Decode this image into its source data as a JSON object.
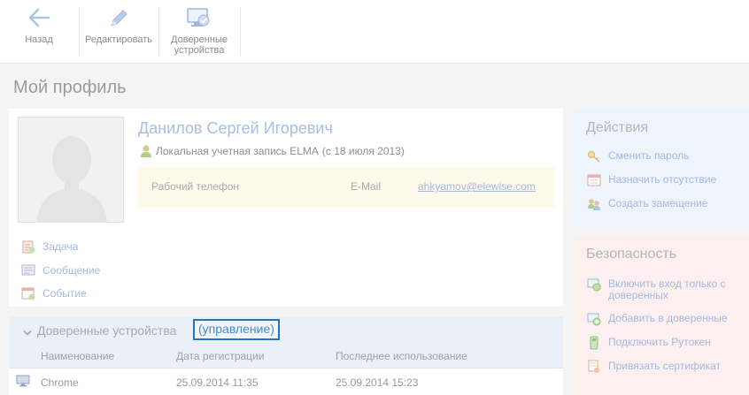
{
  "toolbar": {
    "back_label": "Назад",
    "edit_label": "Редактировать",
    "trusted_label_line1": "Доверенные",
    "trusted_label_line2": "устройства"
  },
  "page": {
    "title": "Мой профиль"
  },
  "profile": {
    "name": "Данилов Сергей Игоревич",
    "account_type": "Локальная учетная запись ELMA",
    "account_since": "(с 18 июля 2013)",
    "phone_label": "Рабочий телефон",
    "email_label": "E-Mail",
    "email": "ahkyamov@elewise.com"
  },
  "quick_actions": {
    "task": "Задача",
    "message": "Сообщение",
    "event": "Событие"
  },
  "devices": {
    "title": "Доверенные устройства",
    "manage_label": "(управление)",
    "columns": [
      "Наименование",
      "Дата регистрации",
      "Последнее использование"
    ],
    "rows": [
      {
        "name": "Chrome",
        "registered": "25.09.2014 11:35",
        "last_used": "25.09.2014 15:23"
      }
    ]
  },
  "actions_panel": {
    "title": "Действия",
    "items": [
      "Сменить пароль",
      "Назначить отсутствие",
      "Создать замещение"
    ]
  },
  "security_panel": {
    "title": "Безопасность",
    "items": [
      "Включить вход только с доверенных",
      "Добавить в доверенные",
      "Подключить Рутокен",
      "Привязать сертификат"
    ]
  },
  "colors": {
    "accent": "#1f77c2",
    "link": "#a4b8de",
    "actions_bg": "#eef4fb",
    "security_bg": "#fbf0ef",
    "contact_bg": "#fff9ec"
  }
}
